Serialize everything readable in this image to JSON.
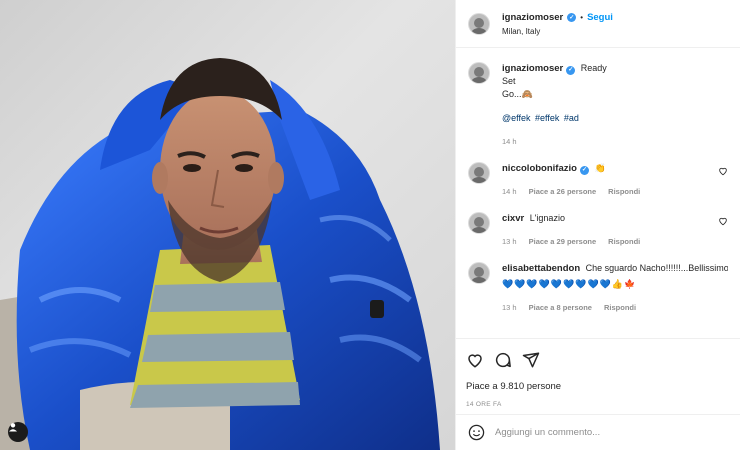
{
  "header": {
    "username": "ignaziomoser",
    "follow_label": "Segui",
    "dot": "•",
    "location": "Milan, Italy"
  },
  "caption": {
    "username": "ignaziomoser",
    "lines": [
      "Ready",
      "Set",
      "Go...🙈"
    ],
    "tags": [
      "@effek",
      "#effek",
      "#ad"
    ],
    "time": "14 h"
  },
  "comments": [
    {
      "username": "niccolobonifazio",
      "text": "👏",
      "time": "14 h",
      "likes": "Piace a 26 persone",
      "reply": "Rispondi"
    },
    {
      "username": "cixvr",
      "text": "L'ignazio",
      "time": "13 h",
      "likes": "Piace a 29 persone",
      "reply": "Rispondi"
    },
    {
      "username": "elisabettabendon",
      "text": "Che sguardo Nacho!!!!!!...Bellissimo c",
      "emoji": "💙💙💙💙💙💙💙💙💙👍🍁",
      "time": "13 h",
      "likes": "Piace a 8 persone",
      "reply": "Rispondi"
    }
  ],
  "actions": {
    "likes": "Piace a 9.810 persone",
    "time_ago": "14 ORE FA"
  },
  "add_comment": {
    "placeholder": "Aggiungi un commento..."
  },
  "icons": [
    "verified-badge-icon",
    "heart-icon",
    "comment-icon",
    "share-icon",
    "emoji-icon",
    "user-tag-icon"
  ],
  "colors": {
    "accent": "#0095f6",
    "jacket": "#1f5fd6",
    "sweater_yellow": "#c9c84a",
    "sweater_grey": "#8fa3ad"
  }
}
